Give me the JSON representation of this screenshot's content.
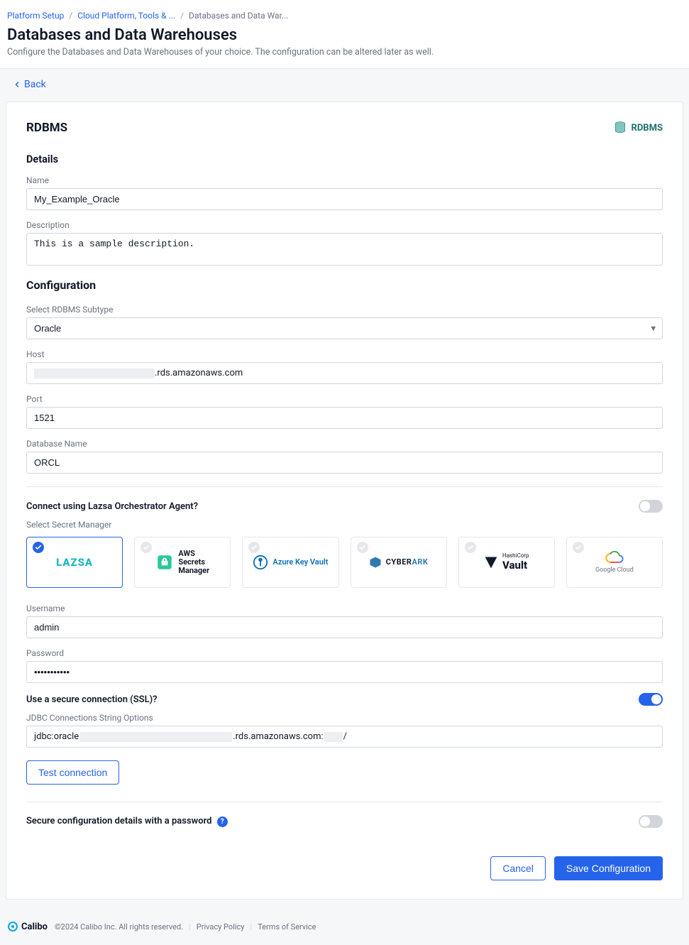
{
  "breadcrumb": {
    "items": [
      {
        "label": "Platform Setup",
        "link": true
      },
      {
        "label": "Cloud Platform, Tools & ...",
        "link": true
      },
      {
        "label": "Databases and Data War...",
        "link": false
      }
    ]
  },
  "page": {
    "title": "Databases and Data Warehouses",
    "subtitle": "Configure the Databases and Data Warehouses of your choice. The configuration can be altered later as well."
  },
  "back": {
    "label": "Back"
  },
  "card": {
    "title": "RDBMS",
    "tag": "RDBMS",
    "details_heading": "Details",
    "name_label": "Name",
    "name_value": "My_Example_Oracle",
    "description_label": "Description",
    "description_value": "This is a sample description.",
    "config_heading": "Configuration",
    "subtype_label": "Select RDBMS Subtype",
    "subtype_value": "Oracle",
    "host_label": "Host",
    "host_suffix": ".rds.amazonaws.com",
    "port_label": "Port",
    "port_value": "1521",
    "dbname_label": "Database Name",
    "dbname_value": "ORCL",
    "orchestrator_q": "Connect using Lazsa Orchestrator Agent?",
    "orchestrator_on": false,
    "secret_label": "Select Secret Manager",
    "secret_managers": [
      {
        "id": "lazsa",
        "selected": true
      },
      {
        "id": "aws",
        "selected": false,
        "small1": "AWS",
        "small2": "Secrets",
        "small3": "Manager"
      },
      {
        "id": "azure",
        "selected": false,
        "label": "Azure Key Vault"
      },
      {
        "id": "cyberark",
        "selected": false
      },
      {
        "id": "vault",
        "selected": false,
        "small1": "HashiCorp",
        "label": "Vault"
      },
      {
        "id": "gcloud",
        "selected": false,
        "label": "Google Cloud"
      }
    ],
    "username_label": "Username",
    "username_value": "admin",
    "password_label": "Password",
    "password_value": "•••••••••••",
    "ssl_q": "Use a secure connection (SSL)?",
    "ssl_on": true,
    "jdbc_label": "JDBC Connections String Options",
    "jdbc_prefix": "jdbc:oracle",
    "jdbc_mid": ".rds.amazonaws.com:",
    "jdbc_suffix": "/",
    "test_conn": "Test connection",
    "secure_q": "Secure configuration details with a password",
    "secure_on": false,
    "cancel": "Cancel",
    "save": "Save Configuration"
  },
  "footer": {
    "brand": "Calibo",
    "copyright": "©2024 Calibo Inc. All rights reserved.",
    "privacy": "Privacy Policy",
    "terms": "Terms of Service"
  }
}
